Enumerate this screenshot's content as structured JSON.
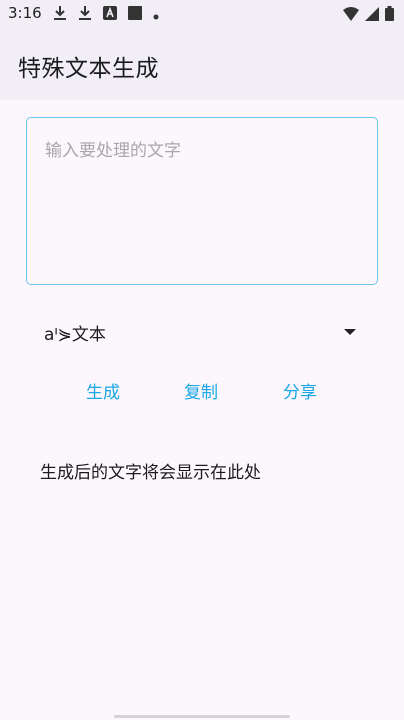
{
  "status_bar": {
    "time": "3:16"
  },
  "app_bar": {
    "title": "特殊文本生成"
  },
  "input": {
    "placeholder": "输入要处理的文字",
    "value": ""
  },
  "style_select": {
    "selected": "aᑊ⋟文本"
  },
  "actions": {
    "generate_label": "生成",
    "copy_label": "复制",
    "share_label": "分享"
  },
  "result": {
    "text": "生成后的文字将会显示在此处"
  },
  "colors": {
    "accent": "#1aa7e6",
    "input_border": "#6ec5ea",
    "background": "#fcf7fd",
    "app_bar": "#f2eef5"
  }
}
